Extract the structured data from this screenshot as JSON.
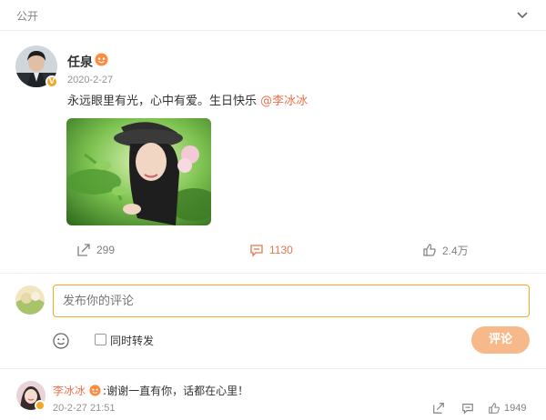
{
  "header": {
    "visibility": "公开",
    "collapse_icon": "chevron-down-icon"
  },
  "post": {
    "author": "任泉",
    "date": "2020-2-27",
    "text": "永远眼里有光，心中有爱。生日快乐 ",
    "mention": "@李冰冰",
    "actions": {
      "share_count": "299",
      "comment_count": "1130",
      "like_count": "2.4万"
    }
  },
  "compose": {
    "placeholder": "发布你的评论",
    "sync_label": "同时转发",
    "submit_label": "评论"
  },
  "comment": {
    "author": "李冰冰",
    "separator": ":",
    "text": "谢谢一直有你，话都在心里！",
    "time": "20-2-27 21:51",
    "like_count": "1949"
  },
  "colors": {
    "accent": "#eb7350",
    "focus": "#f6a623",
    "submit_bg": "#f7b98a",
    "muted": "#939393"
  }
}
